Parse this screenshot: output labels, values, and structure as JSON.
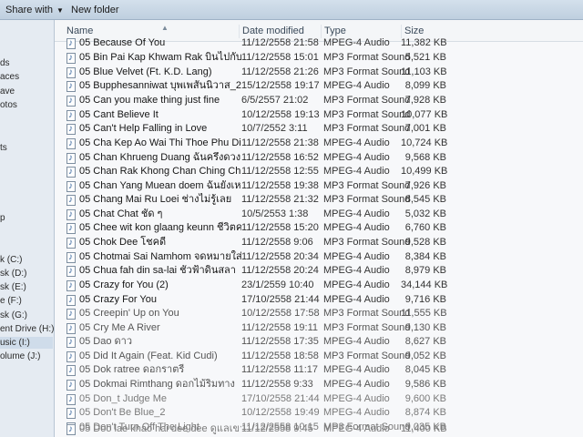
{
  "toolbar": {
    "share_label": "Share with",
    "new_folder_label": "New folder"
  },
  "nav": {
    "items": [
      "ds",
      "aces",
      "ave",
      "otos",
      "ts",
      "p",
      "k (C:)",
      "sk (D:)",
      "sk (E:)",
      "e (F:)",
      "sk (G:)",
      "ent Drive (H:)",
      "usic (I:)",
      "olume (J:)"
    ]
  },
  "columns": {
    "name": "Name",
    "date": "Date modified",
    "type": "Type",
    "size": "Size"
  },
  "files": [
    {
      "name": "05 Because Of You",
      "date": "11/12/2558 21:58",
      "type": "MPEG-4 Audio",
      "size": "11,382 KB"
    },
    {
      "name": "05 Bin Pai Kap Khwam Rak บินไปกับความ",
      "date": "11/12/2558 15:01",
      "type": "MP3 Format Sound",
      "size": "5,521 KB"
    },
    {
      "name": "05 Blue Velvet (Ft. K.D. Lang)",
      "date": "11/12/2558 21:26",
      "type": "MP3 Format Sound",
      "size": "11,103 KB"
    },
    {
      "name": "05 Bupphesanniwat บุพเพสันนิวาส_2",
      "date": "15/12/2558 19:17",
      "type": "MPEG-4 Audio",
      "size": "8,099 KB"
    },
    {
      "name": "05 Can you make thing just fine",
      "date": "6/5/2557 21:02",
      "type": "MP3 Format Sound",
      "size": "7,928 KB"
    },
    {
      "name": "05 Cant Believe It",
      "date": "10/12/2558 19:13",
      "type": "MP3 Format Sound",
      "size": "10,077 KB"
    },
    {
      "name": "05 Can't Help Falling in Love",
      "date": "10/7/2552 3:11",
      "type": "MP3 Format Sound",
      "size": "7,001 KB"
    },
    {
      "name": "05 Cha Kep Ao Wai Thi Thoe Phu Diao",
      "date": "11/12/2558 21:38",
      "type": "MPEG-4 Audio",
      "size": "10,724 KB"
    },
    {
      "name": "05 Chan Khrueng Duang ฉันครึ่งดวง",
      "date": "11/12/2558 16:52",
      "type": "MPEG-4 Audio",
      "size": "9,568 KB"
    },
    {
      "name": "05 Chan Rak Khong Chan Ching Ching ฉ",
      "date": "11/12/2558 12:55",
      "type": "MPEG-4 Audio",
      "size": "10,499 KB"
    },
    {
      "name": "05 Chan Yang Muean doem ฉันยังเหมือน",
      "date": "11/12/2558 19:38",
      "type": "MP3 Format Sound",
      "size": "7,926 KB"
    },
    {
      "name": "05 Chang Mai Ru Loei ช่างไม่รู้เลย",
      "date": "11/12/2558 21:32",
      "type": "MP3 Format Sound",
      "size": "8,545 KB"
    },
    {
      "name": "05 Chat  Chat ชัด ๆ",
      "date": "10/5/2553 1:38",
      "type": "MPEG-4 Audio",
      "size": "5,032 KB"
    },
    {
      "name": "05 Chee wit kon glaang keunn ชีวิตคน",
      "date": "11/12/2558 15:20",
      "type": "MPEG-4 Audio",
      "size": "6,760 KB"
    },
    {
      "name": "05 Chok Dee โชคดี",
      "date": "11/12/2558 9:06",
      "type": "MP3 Format Sound",
      "size": "9,528 KB"
    },
    {
      "name": "05 Chotmai Sai Namhom จดหมายใส่น้ำหอ",
      "date": "11/12/2558 20:34",
      "type": "MPEG-4 Audio",
      "size": "8,384 KB"
    },
    {
      "name": "05 Chua fah din sa-lai ชั่วฟ้าดินสลา",
      "date": "11/12/2558 20:24",
      "type": "MPEG-4 Audio",
      "size": "8,979 KB"
    },
    {
      "name": "05 Crazy for You (2)",
      "date": "23/1/2559 10:40",
      "type": "MPEG-4 Audio",
      "size": "34,144 KB"
    },
    {
      "name": "05 Crazy For You",
      "date": "17/10/2558 21:44",
      "type": "MPEG-4 Audio",
      "size": "9,716 KB"
    },
    {
      "name": "05 Creepin' Up on You",
      "date": "10/12/2558 17:58",
      "type": "MP3 Format Sound",
      "size": "11,555 KB"
    },
    {
      "name": "05 Cry Me A River",
      "date": "11/12/2558 19:11",
      "type": "MP3 Format Sound",
      "size": "9,130 KB"
    },
    {
      "name": "05 Dao ดาว",
      "date": "11/12/2558 17:35",
      "type": "MPEG-4 Audio",
      "size": "8,627 KB"
    },
    {
      "name": "05 Did It Again (Feat. Kid Cudi)",
      "date": "11/12/2558 18:58",
      "type": "MP3 Format Sound",
      "size": "9,052 KB"
    },
    {
      "name": "05 Dok ratree ดอกราตรี",
      "date": "11/12/2558 11:17",
      "type": "MPEG-4 Audio",
      "size": "8,045 KB"
    },
    {
      "name": "05 Dokmai Rimthang ดอกไม้ริมทาง",
      "date": "11/12/2558 9:33",
      "type": "MPEG-4 Audio",
      "size": "9,586 KB"
    },
    {
      "name": "05 Don_t Judge Me",
      "date": "17/10/2558 21:44",
      "type": "MPEG-4 Audio",
      "size": "9,600 KB"
    },
    {
      "name": "05 Don't Be Blue_2",
      "date": "10/12/2558 19:49",
      "type": "MPEG-4 Audio",
      "size": "8,874 KB"
    },
    {
      "name": "05 Don't Turn Off The Light",
      "date": "11/12/2558 10:15",
      "type": "MP3 Format Sound",
      "size": "9,035 KB"
    },
    {
      "name": "05 Doo lae khao hai dee dee ดูแลเขาใ",
      "date": "11/12/2558 9:45",
      "type": "MPEG-4 Audio",
      "size": "11,400 KB"
    }
  ]
}
